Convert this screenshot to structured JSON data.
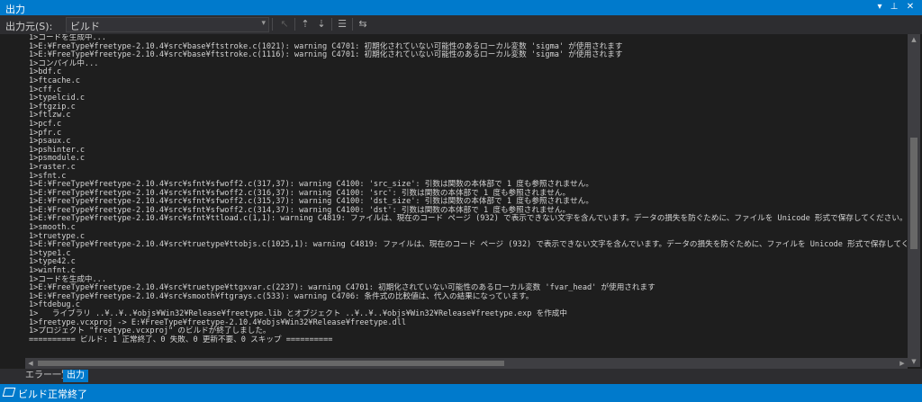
{
  "window": {
    "title": "出力",
    "menu_icon": "▾",
    "pin_icon": "⊥",
    "close_icon": "✕"
  },
  "toolbar": {
    "source_label": "出力元(S):",
    "source_value": "ビルド",
    "dropdown_arrow": "▾",
    "tools": {
      "goto": "↖",
      "prev": "⇡",
      "next": "⇣",
      "clear": "☰",
      "wrap": "⇆"
    }
  },
  "output_lines": [
    "1>コードを生成中...",
    "1>E:¥FreeType¥freetype-2.10.4¥src¥base¥ftstroke.c(1021): warning C4701: 初期化されていない可能性のあるローカル変数 'sigma' が使用されます",
    "1>E:¥FreeType¥freetype-2.10.4¥src¥base¥ftstroke.c(1116): warning C4701: 初期化されていない可能性のあるローカル変数 'sigma' が使用されます",
    "1>コンパイル中...",
    "1>bdf.c",
    "1>ftcache.c",
    "1>cff.c",
    "1>typelcid.c",
    "1>ftgzip.c",
    "1>ftlzw.c",
    "1>pcf.c",
    "1>pfr.c",
    "1>psaux.c",
    "1>pshinter.c",
    "1>psmodule.c",
    "1>raster.c",
    "1>sfnt.c",
    "1>E:¥FreeType¥freetype-2.10.4¥src¥sfnt¥sfwoff2.c(317,37): warning C4100: 'src_size': 引数は関数の本体部で 1 度も参照されません。",
    "1>E:¥FreeType¥freetype-2.10.4¥src¥sfnt¥sfwoff2.c(316,37): warning C4100: 'src': 引数は関数の本体部で 1 度も参照されません。",
    "1>E:¥FreeType¥freetype-2.10.4¥src¥sfnt¥sfwoff2.c(315,37): warning C4100: 'dst_size': 引数は関数の本体部で 1 度も参照されません。",
    "1>E:¥FreeType¥freetype-2.10.4¥src¥sfnt¥sfwoff2.c(314,37): warning C4100: 'dst': 引数は関数の本体部で 1 度も参照されません。",
    "1>E:¥FreeType¥freetype-2.10.4¥src¥sfnt¥ttload.c(1,1): warning C4819: ファイルは、現在のコード ページ (932) で表示できない文字を含んでいます。データの損失を防ぐために、ファイルを Unicode 形式で保存してください。",
    "1>smooth.c",
    "1>truetype.c",
    "1>E:¥FreeType¥freetype-2.10.4¥src¥truetype¥ttobjs.c(1025,1): warning C4819: ファイルは、現在のコード ページ (932) で表示できない文字を含んでいます。データの損失を防ぐために、ファイルを Unicode 形式で保存してください。",
    "1>type1.c",
    "1>type42.c",
    "1>winfnt.c",
    "1>コードを生成中...",
    "1>E:¥FreeType¥freetype-2.10.4¥src¥truetype¥ttgxvar.c(2237): warning C4701: 初期化されていない可能性のあるローカル変数 'fvar_head' が使用されます",
    "1>E:¥FreeType¥freetype-2.10.4¥src¥smooth¥ftgrays.c(533): warning C4706: 条件式の比較値は、代入の結果になっています。",
    "1>ftdebug.c",
    "1>   ライブラリ ..¥..¥..¥objs¥Win32¥Release¥freetype.lib とオブジェクト ..¥..¥..¥objs¥Win32¥Release¥freetype.exp を作成中",
    "1>freetype.vcxproj -> E:¥FreeType¥freetype-2.10.4¥objs¥Win32¥Release¥freetype.dll",
    "1>プロジェクト \"freetype.vcxproj\" のビルドが終了しました。",
    "========== ビルド: 1 正常終了、0 失敗、0 更新不要、0 スキップ =========="
  ],
  "scrollbars": {
    "up": "▲",
    "down": "▼",
    "left": "◀",
    "right": "▶"
  },
  "tabs": [
    {
      "label": "エラー一覧",
      "active": false
    },
    {
      "label": "出力",
      "active": true
    }
  ],
  "status": {
    "text": "ビルド正常終了"
  },
  "colors": {
    "accent": "#007acc",
    "background": "#1e1e1e",
    "panel": "#2d2d30",
    "text": "#d4d4d4"
  }
}
